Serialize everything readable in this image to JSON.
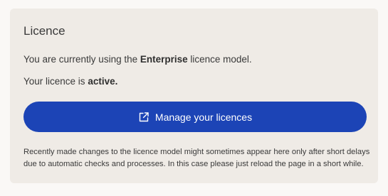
{
  "licence": {
    "title": "Licence",
    "model_prefix": "You are currently using the ",
    "model_name": "Enterprise",
    "model_suffix": " licence model.",
    "status_prefix": "Your licence is ",
    "status_value": "active.",
    "manage_button_label": "Manage your licences",
    "manage_button_icon": "external-link-icon",
    "note": "Recently made changes to the licence model might sometimes appear here only after short delays due to automatic checks and processes. In this case please just reload the page in a short while."
  },
  "colors": {
    "page_background": "#faf8f6",
    "card_background": "#efebe6",
    "button_background": "#1c44b6",
    "button_text": "#ffffff",
    "text": "#3a3a3a"
  }
}
